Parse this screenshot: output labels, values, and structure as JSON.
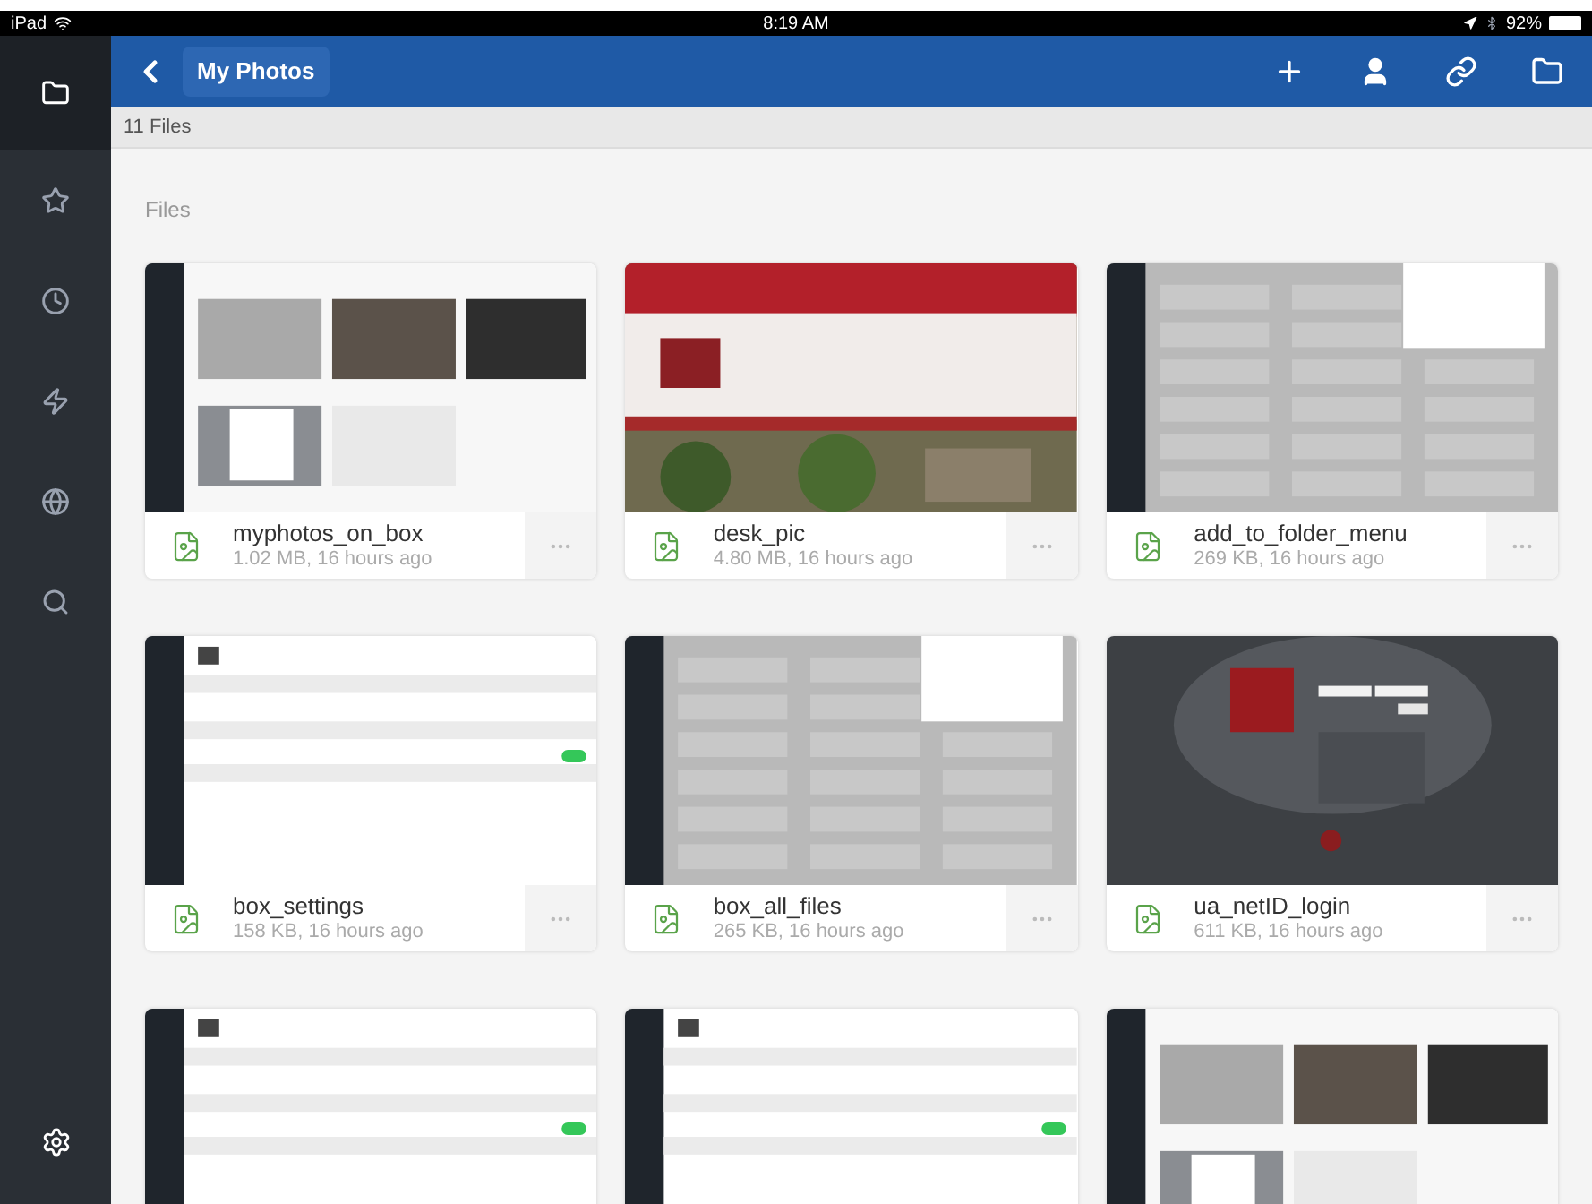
{
  "status_bar": {
    "device": "iPad",
    "time": "8:19 AM",
    "battery": "92%"
  },
  "sidebar": {
    "items": [
      {
        "selected": true
      },
      {
        "selected": false
      },
      {
        "selected": false
      },
      {
        "selected": false
      },
      {
        "selected": false
      },
      {
        "selected": false
      }
    ]
  },
  "header": {
    "title": "My Photos"
  },
  "count": "11 Files",
  "section": "Files",
  "files": [
    {
      "kind": "file",
      "name": "myphotos_on_box",
      "meta": "1.02 MB, 16 hours ago"
    },
    {
      "kind": "file",
      "name": "desk_pic",
      "meta": "4.80 MB, 16 hours ago"
    },
    {
      "kind": "file",
      "name": "add_to_folder_menu",
      "meta": "269 KB, 16 hours ago"
    },
    {
      "kind": "file",
      "name": "box_settings",
      "meta": "158 KB, 16 hours ago"
    },
    {
      "kind": "file",
      "name": "box_all_files",
      "meta": "265 KB, 16 hours ago"
    },
    {
      "kind": "file",
      "name": "ua_netID_login",
      "meta": "611 KB, 16 hours ago"
    },
    {
      "kind": "picture"
    },
    {
      "kind": "picture"
    },
    {
      "kind": "picture"
    }
  ]
}
